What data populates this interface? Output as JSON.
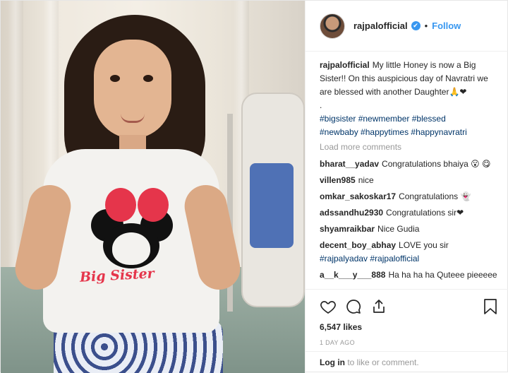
{
  "post": {
    "username": "rajpalofficial",
    "verified_glyph": "✔",
    "separator": "•",
    "follow_label": "Follow",
    "image_shirt_text": "Big Sister"
  },
  "caption": {
    "user": "rajpalofficial",
    "text": "My little Honey is now a Big Sister!! On this auspicious day of Navratri we are blessed with another Daughter🙏❤",
    "dot": ".",
    "hashtags_line1": "#bigsister #newmember #blessed",
    "hashtags_line2": "#newbaby #happytimes #happynavratri"
  },
  "load_more_label": "Load more comments",
  "comments": [
    {
      "user": "bharat__yadav",
      "text": "Congratulations bhaiya 😮 😋"
    },
    {
      "user": "villen985",
      "text": "nice"
    },
    {
      "user": "omkar_sakoskar17",
      "text": "Congratulations 👻"
    },
    {
      "user": "adssandhu2930",
      "text": "Congratulations sir❤"
    },
    {
      "user": "shyamraikbar",
      "text": "Nice Gudia"
    },
    {
      "user": "decent_boy_abhay",
      "text": "LOVE you sir",
      "tags": "#rajpalyadav #rajpalofficial"
    },
    {
      "user": "a__k___y___888",
      "text": "Ha ha ha ha Quteee pieeeee"
    }
  ],
  "actions": {
    "like_icon": "heart-icon",
    "comment_icon": "comment-icon",
    "share_icon": "share-icon",
    "save_icon": "bookmark-icon"
  },
  "likes": "6,547 likes",
  "time_ago": "1 DAY AGO",
  "login": {
    "link": "Log in",
    "rest": " to like or comment."
  }
}
